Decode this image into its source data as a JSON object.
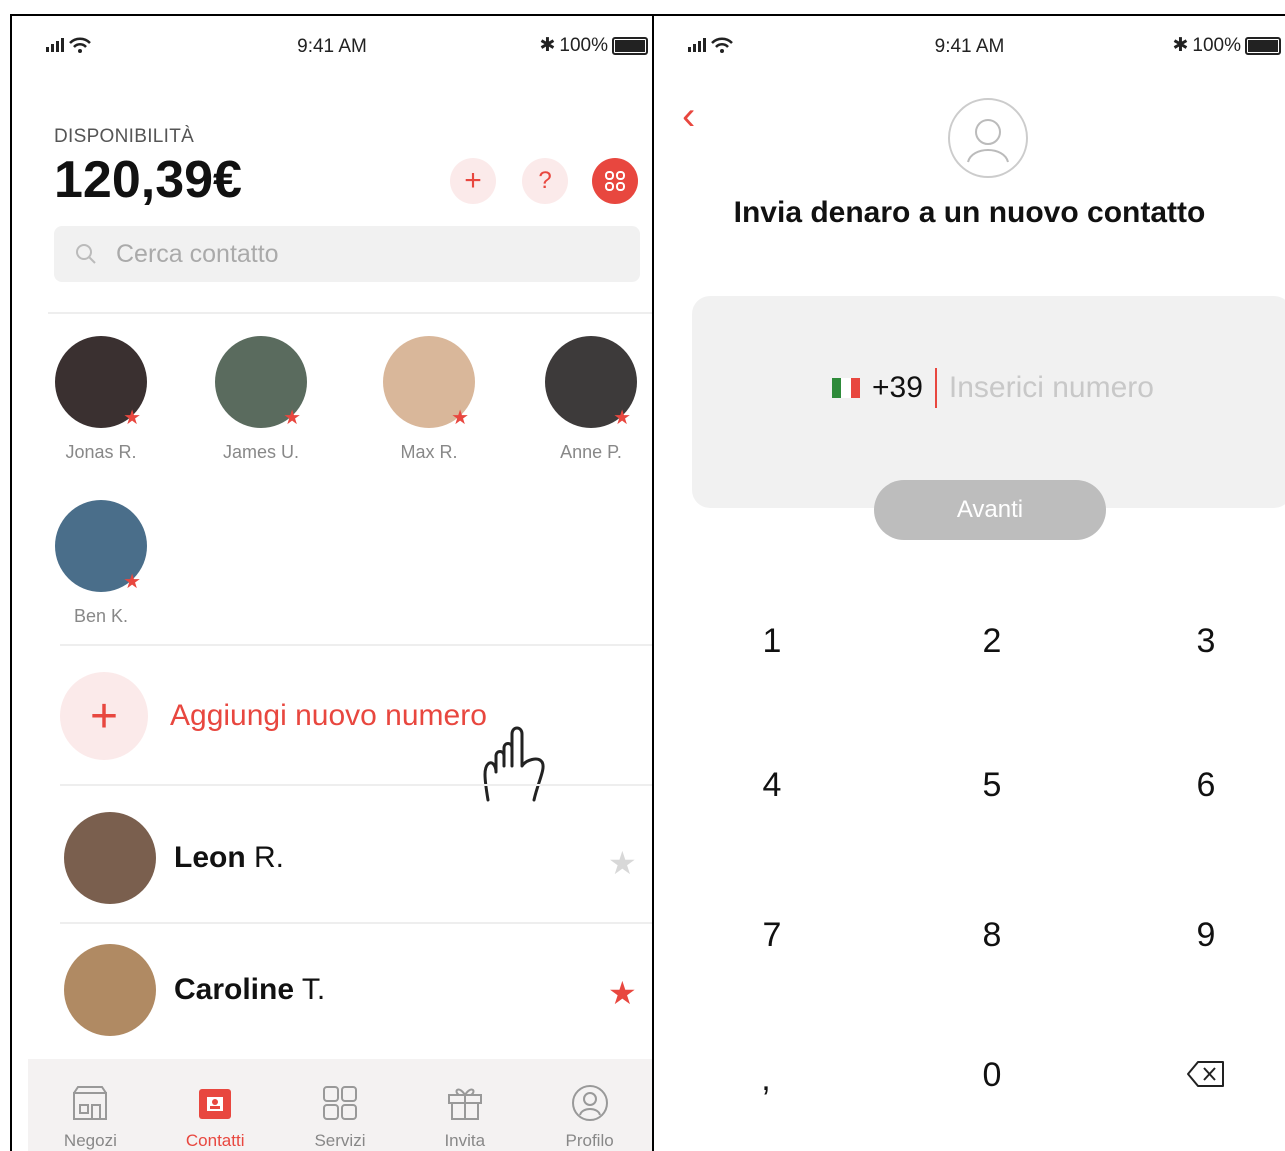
{
  "status": {
    "time": "9:41 AM",
    "battery": "100%"
  },
  "left": {
    "balance_label": "DISPONIBILITÀ",
    "balance": "120,39€",
    "buttons": {
      "add": "+",
      "help": "?"
    },
    "search_placeholder": "Cerca contatto",
    "favorites": [
      {
        "name": "Jonas R.",
        "color": "#3a3030"
      },
      {
        "name": "James U.",
        "color": "#5a6b5e"
      },
      {
        "name": "Max R.",
        "color": "#d9b79a"
      },
      {
        "name": "Anne P.",
        "color": "#3d3a3a"
      },
      {
        "name": "Ben K.",
        "color": "#4a6e8a"
      }
    ],
    "add_number": "Aggiungi nuovo numero",
    "contacts": [
      {
        "first": "Leon",
        "last": "R.",
        "starred": false,
        "color": "#7a5f4e"
      },
      {
        "first": "Caroline",
        "last": "T.",
        "starred": true,
        "color": "#b08a63"
      }
    ],
    "tabs": [
      {
        "label": "Negozi",
        "icon": "shop-icon",
        "active": false
      },
      {
        "label": "Contatti",
        "icon": "contacts-icon",
        "active": true
      },
      {
        "label": "Servizi",
        "icon": "services-grid-icon",
        "active": false
      },
      {
        "label": "Invita",
        "icon": "gift-icon",
        "active": false
      },
      {
        "label": "Profilo",
        "icon": "profile-icon",
        "active": false
      }
    ]
  },
  "right": {
    "title": "Invia denaro a un nuovo contatto",
    "prefix": "+39",
    "phone_placeholder": "Inserici numero",
    "next_button": "Avanti",
    "keys": [
      "1",
      "2",
      "3",
      "4",
      "5",
      "6",
      "7",
      "8",
      "9",
      ",",
      "0"
    ]
  },
  "colors": {
    "accent": "#e8473f",
    "muted": "#888888"
  }
}
